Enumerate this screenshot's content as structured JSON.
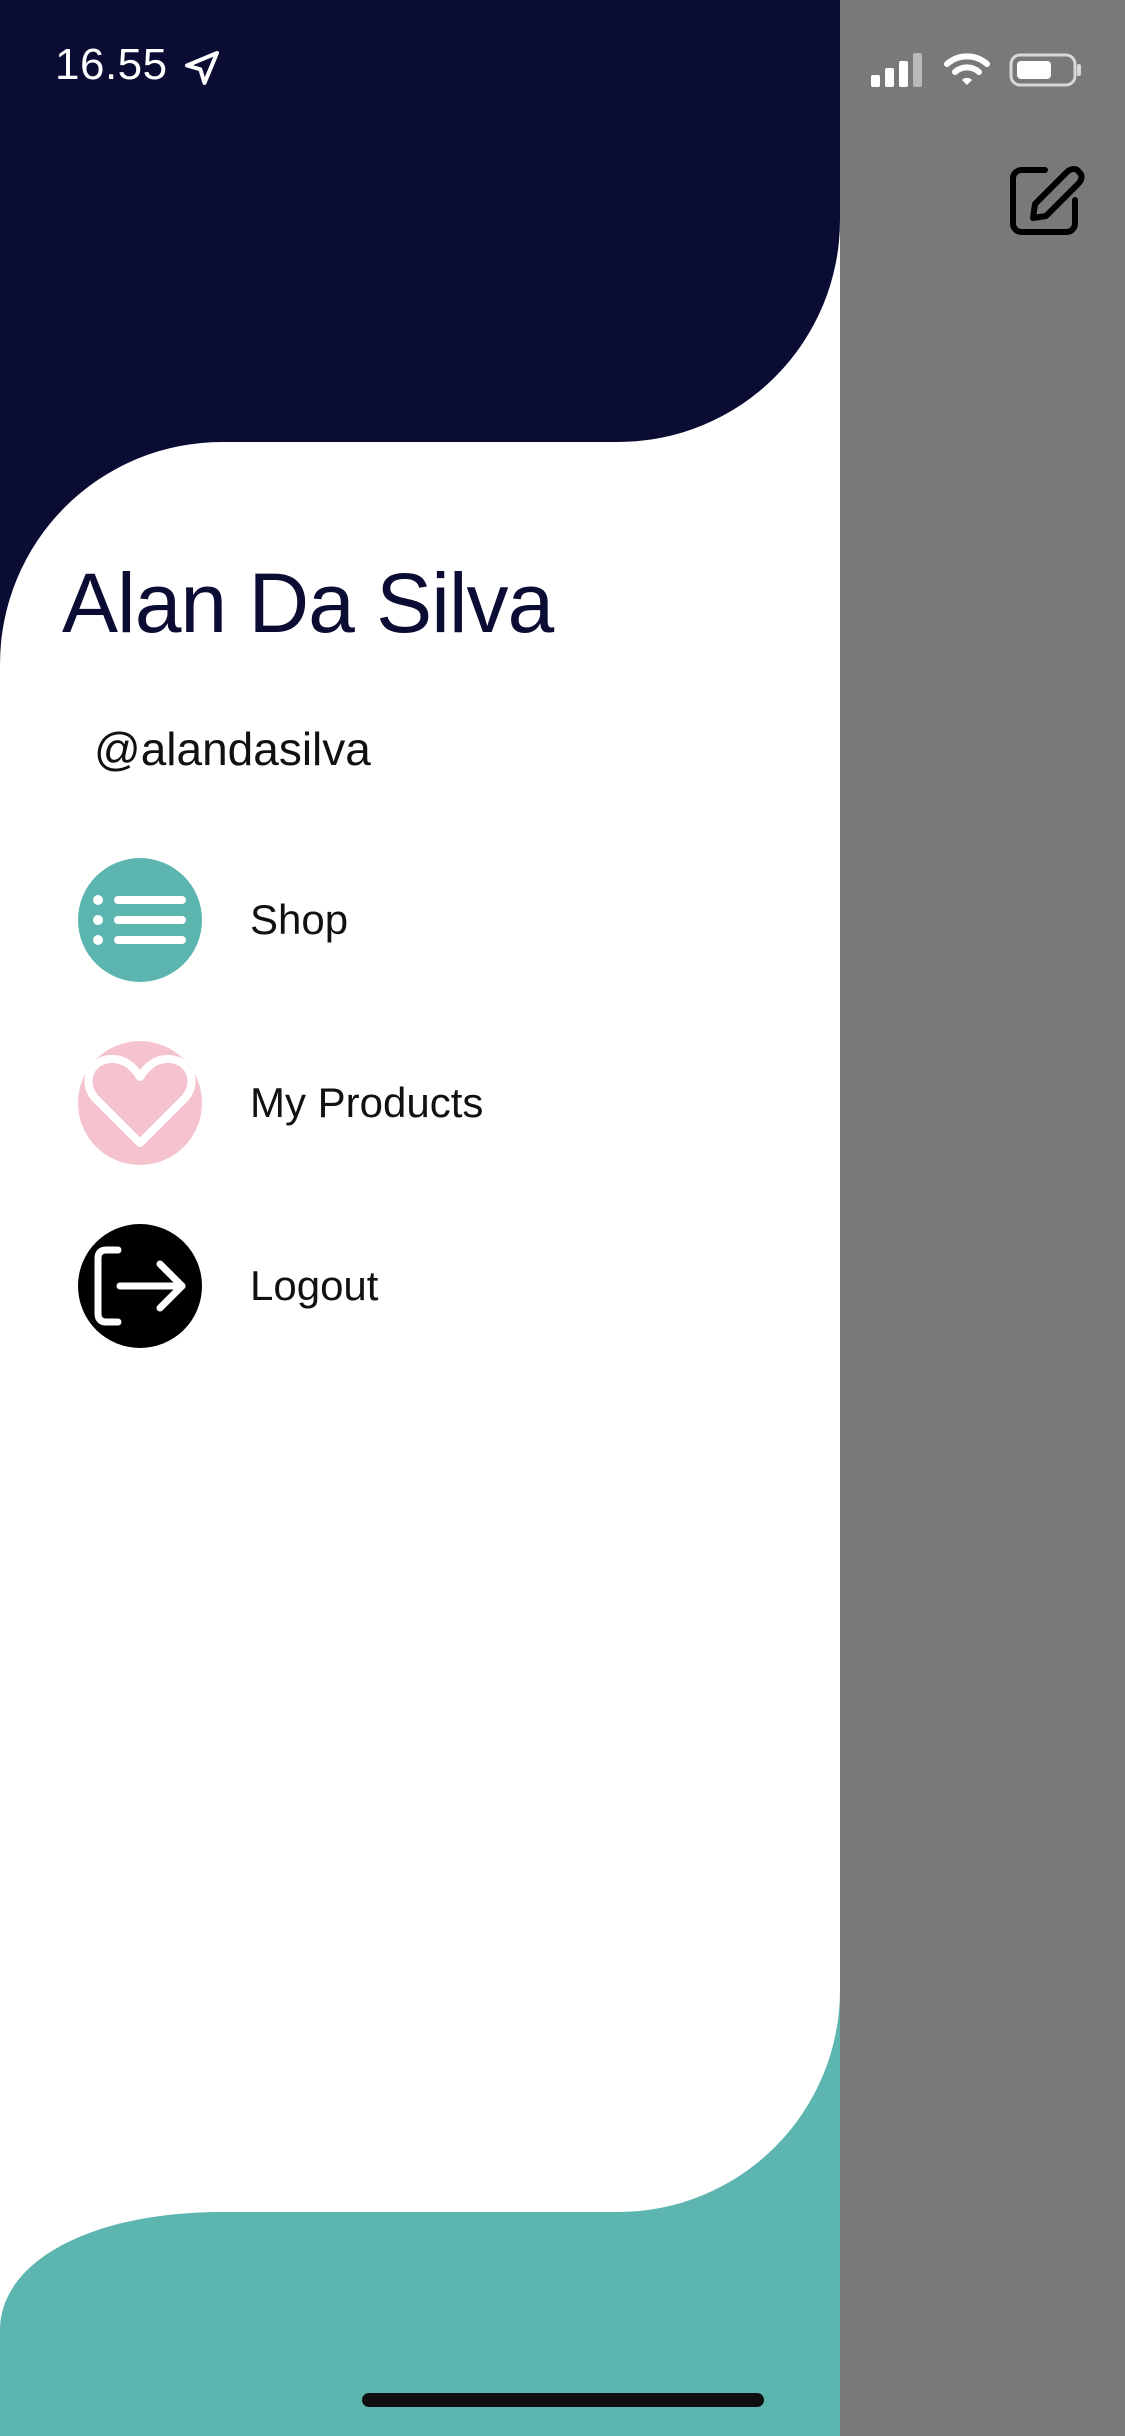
{
  "status_bar": {
    "time": "16.55",
    "icons": [
      "location-arrow-icon",
      "cellular-signal-icon",
      "wifi-icon",
      "battery-icon"
    ]
  },
  "header": {
    "edit_icon": "edit-icon"
  },
  "profile": {
    "name": "Alan Da Silva",
    "handle": "@alandasilva"
  },
  "menu": {
    "items": [
      {
        "label": "Shop",
        "icon": "list-icon",
        "icon_bg": "#5db5af"
      },
      {
        "label": "My Products",
        "icon": "heart-icon",
        "icon_bg": "#f5c3ce"
      },
      {
        "label": "Logout",
        "icon": "logout-icon",
        "icon_bg": "#000000"
      }
    ]
  },
  "colors": {
    "header_navy": "#0b0c33",
    "accent_teal": "#5db5af",
    "overlay_gray": "#797979",
    "drawer_white": "#ffffff"
  }
}
